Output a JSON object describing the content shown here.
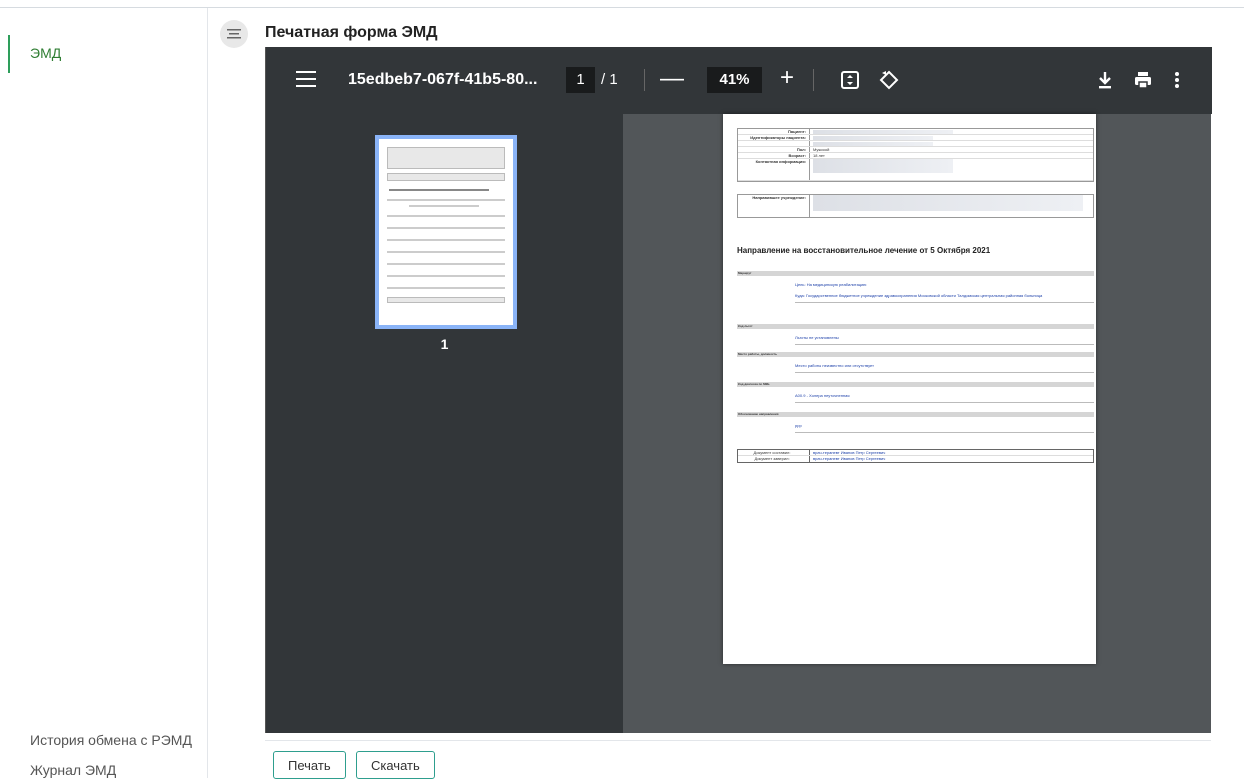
{
  "sidebar": {
    "active_item": "ЭМД",
    "bottom_items": [
      "История обмена с РЭМД",
      "Журнал ЭМД"
    ]
  },
  "header": {
    "title": "Печатная форма ЭМД"
  },
  "viewer": {
    "file_name": "15edbeb7-067f-41b5-80...",
    "page_current": "1",
    "page_total": "/ 1",
    "zoom": "41%",
    "thumbnail_label": "1"
  },
  "document": {
    "patient_rows": [
      {
        "label": "Пациент:",
        "value": ""
      },
      {
        "label": "Идентификаторы пациента:",
        "value": ""
      },
      {
        "label": "Пол:",
        "value": "Мужской"
      },
      {
        "label": "Возраст:",
        "value": "18 лет"
      },
      {
        "label": "Контактная информация:",
        "value": ""
      }
    ],
    "institution_label": "Направившее учреждение:",
    "heading": "Направление на восстановительное лечение от 5 Октября 2021",
    "sections": [
      {
        "header": "Маршрут",
        "lines": [
          "Цель: На медицинскую реабилитацию",
          "Куда: Государственное бюджетное учреждение здравоохранения Московской области Талдомская центральная районная больница"
        ]
      },
      {
        "header": "Код льгот",
        "lines": [
          "Льготы не установлены"
        ]
      },
      {
        "header": "Место работы, должность",
        "lines": [
          "Место работы неизвестно или отсутствует"
        ]
      },
      {
        "header": "Код диагноза по МКБ",
        "lines": [
          "A00.9 - Холера неуточненная"
        ]
      },
      {
        "header": "Обоснование направления",
        "lines": [
          "ррр"
        ]
      }
    ],
    "footer_rows": [
      {
        "label": "Документ составил:",
        "value": "врач-терапевт Иванов Петр Сергеевич"
      },
      {
        "label": "Документ заверил:",
        "value": "врач-терапевт Иванов Петр Сергеевич"
      }
    ]
  },
  "actions": {
    "print_label": "Печать",
    "download_label": "Скачать"
  }
}
